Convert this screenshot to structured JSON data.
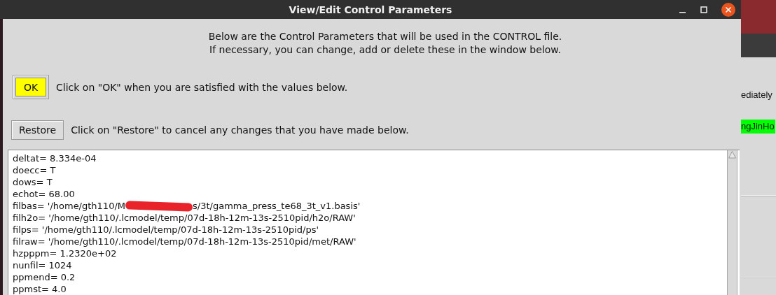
{
  "window": {
    "title": "View/Edit Control Parameters"
  },
  "intro": [
    "Below are the Control Parameters that will be used in the CONTROL file.",
    "If necessary, you can change, add or delete these in the window below."
  ],
  "ok": {
    "label": "OK",
    "hint": "Click on \"OK\" when you are satisfied with the values below."
  },
  "restore": {
    "label": "Restore",
    "hint": "Click on \"Restore\" to cancel any changes that you have made below."
  },
  "parameters": [
    {
      "kind": "plain",
      "text": "deltat= 8.334e-04"
    },
    {
      "kind": "plain",
      "text": "doecc= T"
    },
    {
      "kind": "plain",
      "text": "dows= T"
    },
    {
      "kind": "plain",
      "text": "echot= 68.00"
    },
    {
      "kind": "redacted",
      "before": "filbas= '/home/gth110/M",
      "after": "s/3t/gamma_press_te68_3t_v1.basis'"
    },
    {
      "kind": "plain",
      "text": "filh2o= '/home/gth110/.lcmodel/temp/07d-18h-12m-13s-2510pid/h2o/RAW'"
    },
    {
      "kind": "plain",
      "text": "filps= '/home/gth110/.lcmodel/temp/07d-18h-12m-13s-2510pid/ps'"
    },
    {
      "kind": "plain",
      "text": "filraw= '/home/gth110/.lcmodel/temp/07d-18h-12m-13s-2510pid/met/RAW'"
    },
    {
      "kind": "plain",
      "text": "hzpppm= 1.2320e+02"
    },
    {
      "kind": "plain",
      "text": "nunfil= 1024"
    },
    {
      "kind": "plain",
      "text": "ppmend= 0.2"
    },
    {
      "kind": "plain",
      "text": "ppmst= 4.0"
    }
  ],
  "background_window": {
    "texts": [
      {
        "kind": "plain",
        "text": "ediately"
      },
      {
        "kind": "highlight",
        "text": "ngJinHo"
      }
    ]
  }
}
